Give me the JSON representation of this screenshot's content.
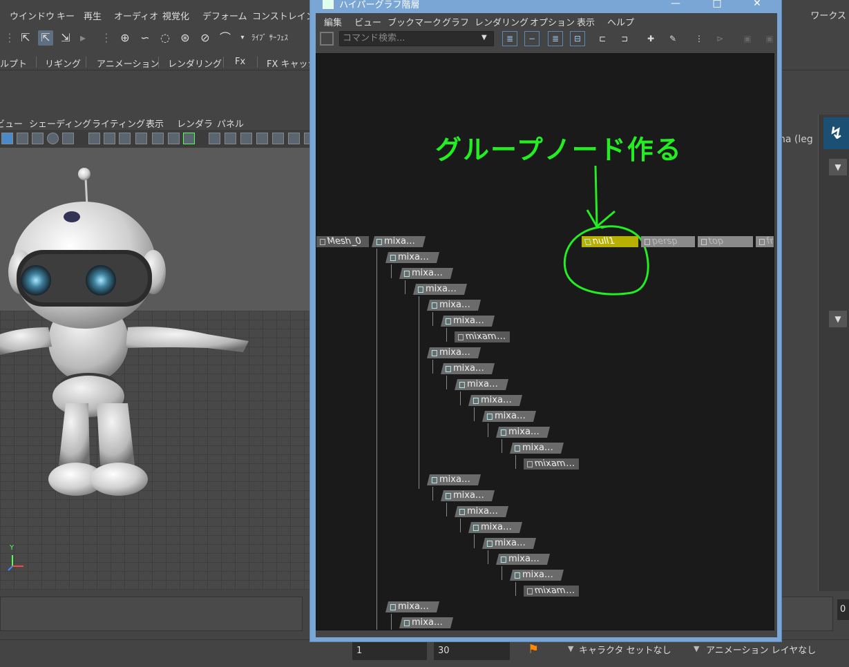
{
  "maya": {
    "menu": [
      "ウインドウ",
      "キー",
      "再生",
      "オーディオ",
      "視覚化",
      "デフォーム",
      "コンストレイント"
    ],
    "workspace_label": "ワークス",
    "live_surface": "ﾗｲﾌﾞ ｻｰﾌｪｽ",
    "shelf_tabs": [
      "ルプト",
      "リギング",
      "アニメーション",
      "レンダリング",
      "Fx",
      "FX キャッシ"
    ],
    "viewport_menu": [
      "ビュー",
      "シェーディング",
      "ライティング",
      "表示",
      "レンダラ",
      "パネル"
    ],
    "camera_label": "na (leg",
    "axis_label": "Y",
    "timeline_end_frame": "0"
  },
  "range": {
    "start": "1",
    "end": "30",
    "character_set": "キャラクタ セットなし",
    "anim_layer": "アニメーション レイヤなし"
  },
  "hypergraph": {
    "title": "ハイパーグラフ階層",
    "menu": [
      "編集",
      "ビュー",
      "ブックマーク",
      "グラフ",
      "レンダリング",
      "オプション",
      "表示",
      "ヘルプ"
    ],
    "search_placeholder": "コマンド検索...",
    "annotation": "グループノード作る",
    "nodes": {
      "mesh": "Mesh_0",
      "null": "null1",
      "persp": "persp",
      "top": "top",
      "front": "fr",
      "mixa": "mixa…",
      "mixam": "mixam…"
    }
  },
  "colors": {
    "accent_blue": "#7aa6d6",
    "selected_node": "#b8b000",
    "annotation_green": "#22ee22"
  }
}
